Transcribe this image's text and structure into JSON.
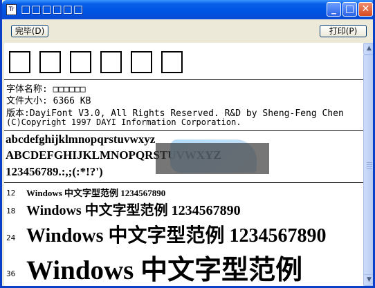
{
  "window": {
    "title": "□□□□□□",
    "app_icon": "font-file-icon",
    "controls": {
      "minimize": "_",
      "maximize": "□",
      "close": "✕"
    }
  },
  "toolbar": {
    "done_label": "完毕(D)",
    "print_label": "打印(P)"
  },
  "preview": {
    "glyph_boxes": [
      "□",
      "□",
      "□",
      "□",
      "□",
      "□"
    ],
    "font_name_label": "字体名称:",
    "font_name_value": "□□□□□□",
    "file_size_label": "文件大小:",
    "file_size_value": "6366 KB",
    "version_label": "版本:",
    "version_value": "DayiFont V3.0, All Rights Reserved. R&D by Sheng-Feng Chen",
    "copyright": "(C)Copyright 1997 DAYI Information Corporation.",
    "charset_lower": "abcdefghijklmnopqrstuvwxyz",
    "charset_upper": "ABCDEFGHIJKLMNOPQRSTUVWXYZ",
    "charset_digits": "123456789.:,;(:*!?')",
    "samples": [
      {
        "size": "12",
        "text": "Windows 中文字型范例 1234567890"
      },
      {
        "size": "18",
        "text": "Windows 中文字型范例 1234567890"
      },
      {
        "size": "24",
        "text": "Windows 中文字型范例 1234567890"
      },
      {
        "size": "36",
        "text": "Windows 中文字型范例"
      }
    ]
  },
  "scrollbar": {
    "up": "▲",
    "down": "▼"
  },
  "colors": {
    "titlebar": "#0054e3",
    "chrome": "#ece9d8",
    "close": "#d84a20"
  }
}
